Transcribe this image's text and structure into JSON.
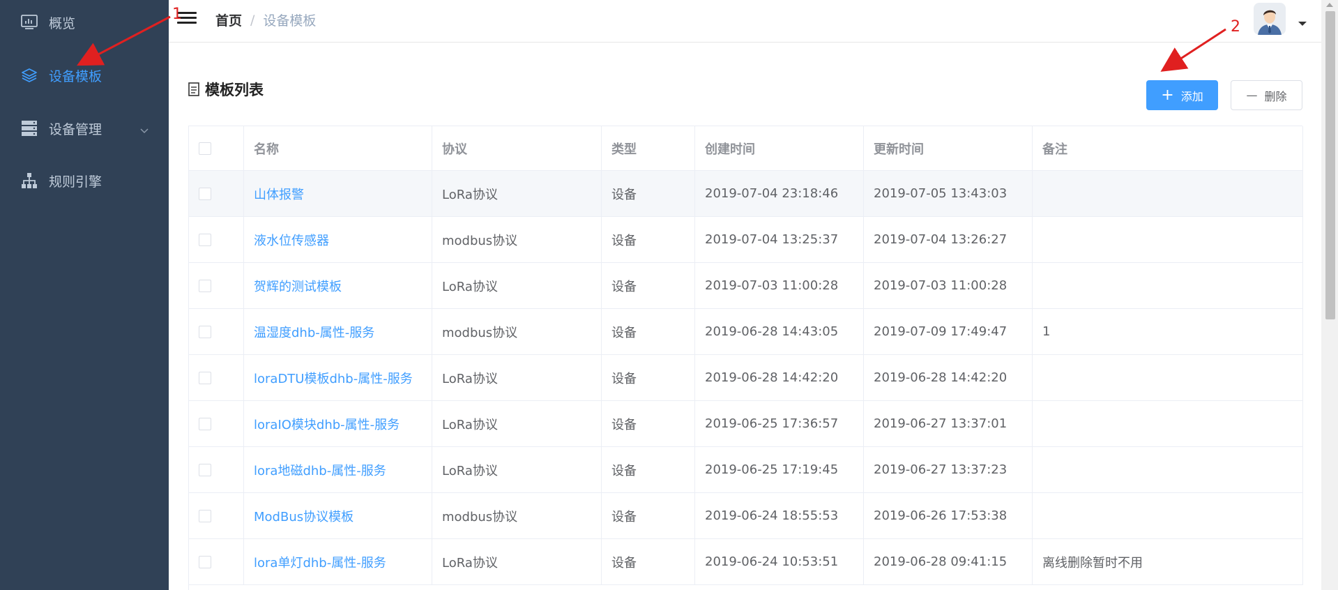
{
  "sidebar": {
    "items": [
      {
        "label": "概览",
        "icon": "dashboard-icon",
        "active": false
      },
      {
        "label": "设备模板",
        "icon": "layers-icon",
        "active": true
      },
      {
        "label": "设备管理",
        "icon": "server-icon",
        "active": false,
        "has_submenu": true
      },
      {
        "label": "规则引擎",
        "icon": "sitemap-icon",
        "active": false
      }
    ]
  },
  "header": {
    "breadcrumb": {
      "home": "首页",
      "separator": "/",
      "current": "设备模板"
    },
    "avatar_icon": "user-avatar"
  },
  "main": {
    "panel_title": "模板列表",
    "add_button": "添加",
    "delete_button": "删除",
    "table": {
      "columns": [
        "名称",
        "协议",
        "类型",
        "创建时间",
        "更新时间",
        "备注"
      ],
      "rows": [
        {
          "name": "山体报警",
          "protocol": "LoRa协议",
          "type": "设备",
          "created": "2019-07-04 23:18:46",
          "updated": "2019-07-05 13:43:03",
          "remark": ""
        },
        {
          "name": "液水位传感器",
          "protocol": "modbus协议",
          "type": "设备",
          "created": "2019-07-04 13:25:37",
          "updated": "2019-07-04 13:26:27",
          "remark": ""
        },
        {
          "name": "贺辉的测试模板",
          "protocol": "LoRa协议",
          "type": "设备",
          "created": "2019-07-03 11:00:28",
          "updated": "2019-07-03 11:00:28",
          "remark": ""
        },
        {
          "name": "温湿度dhb-属性-服务",
          "protocol": "modbus协议",
          "type": "设备",
          "created": "2019-06-28 14:43:05",
          "updated": "2019-07-09 17:49:47",
          "remark": "1"
        },
        {
          "name": "loraDTU模板dhb-属性-服务",
          "protocol": "LoRa协议",
          "type": "设备",
          "created": "2019-06-28 14:42:20",
          "updated": "2019-06-28 14:42:20",
          "remark": ""
        },
        {
          "name": "loraIO模块dhb-属性-服务",
          "protocol": "LoRa协议",
          "type": "设备",
          "created": "2019-06-25 17:36:57",
          "updated": "2019-06-27 13:37:01",
          "remark": ""
        },
        {
          "name": "lora地磁dhb-属性-服务",
          "protocol": "LoRa协议",
          "type": "设备",
          "created": "2019-06-25 17:19:45",
          "updated": "2019-06-27 13:37:23",
          "remark": ""
        },
        {
          "name": "ModBus协议模板",
          "protocol": "modbus协议",
          "type": "设备",
          "created": "2019-06-24 18:55:53",
          "updated": "2019-06-26 17:53:38",
          "remark": ""
        },
        {
          "name": "lora单灯dhb-属性-服务",
          "protocol": "LoRa协议",
          "type": "设备",
          "created": "2019-06-24 10:53:51",
          "updated": "2019-06-28 09:41:15",
          "remark": "离线删除暂时不用"
        }
      ]
    }
  },
  "annotations": {
    "marker_1": "1",
    "marker_2": "2",
    "color": "#e02020"
  },
  "colors": {
    "sidebar_bg": "#304156",
    "accent": "#409eff"
  }
}
